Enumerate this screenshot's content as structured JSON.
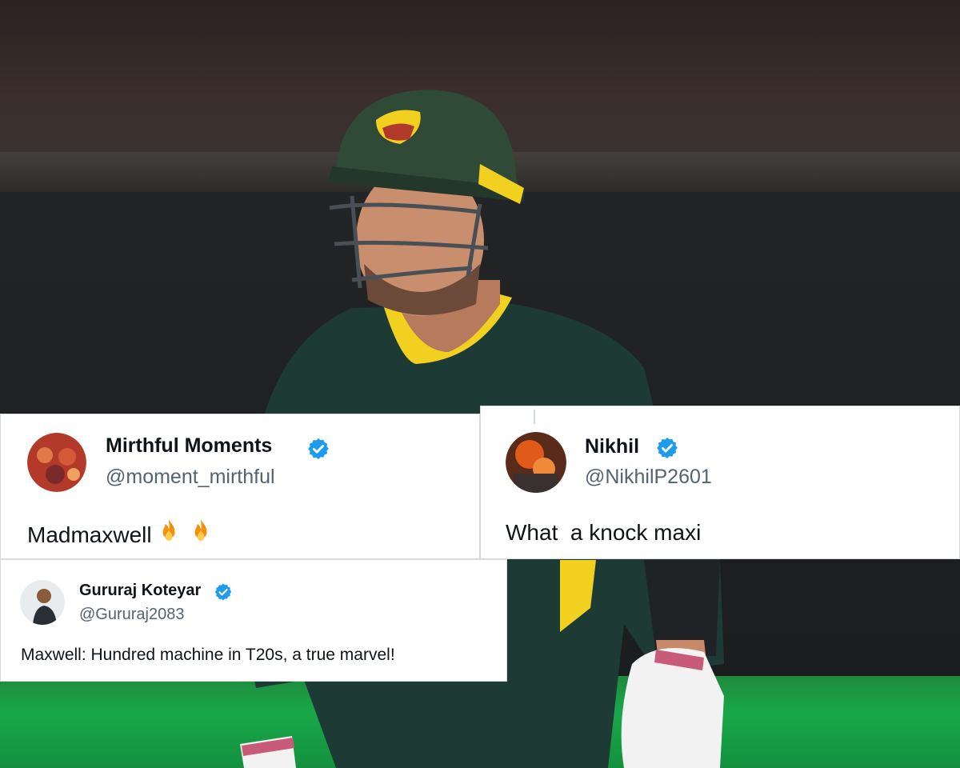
{
  "tweets": [
    {
      "name": "Mirthful Moments",
      "handle": "@moment_mirthful",
      "text": "Madmaxwell",
      "emoji": [
        "fire-emoji",
        "fire-emoji"
      ]
    },
    {
      "name": "Nikhil",
      "handle": "@NikhilP2601",
      "text": "What  a knock maxi"
    },
    {
      "name": "Gururaj Koteyar",
      "handle": "@Gururaj2083",
      "text": "Maxwell: Hundred machine in T20s, a true marvel!"
    }
  ],
  "colors": {
    "verified_badge": "#1d9bf0",
    "handle_gray": "#536471",
    "text_dark": "#0f1419",
    "jersey_yellow": "#f2d020",
    "jersey_green": "#1e3a35",
    "grass_green": "#18a84a"
  }
}
